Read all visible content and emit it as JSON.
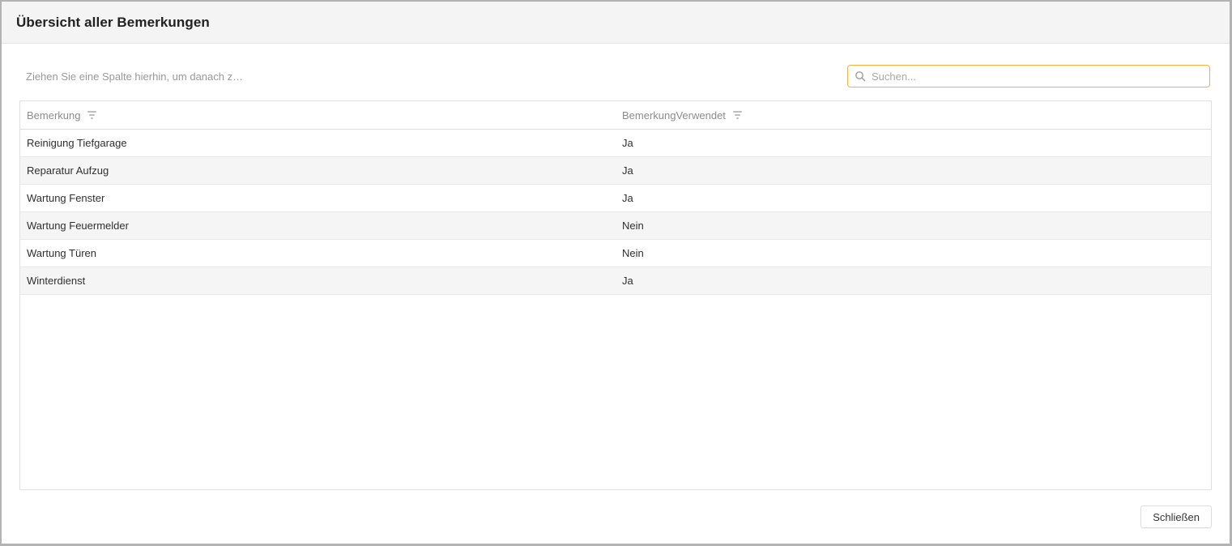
{
  "dialog": {
    "title": "Übersicht aller Bemerkungen"
  },
  "grid": {
    "group_panel_text": "Ziehen Sie eine Spalte hierhin, um danach z…",
    "search": {
      "placeholder": "Suchen...",
      "value": "",
      "icon": "magnifier"
    },
    "columns": [
      {
        "label": "Bemerkung",
        "filter_icon": "funnel"
      },
      {
        "label": "BemerkungVerwendet",
        "filter_icon": "funnel"
      }
    ],
    "rows": [
      {
        "bemerkung": "Reinigung Tiefgarage",
        "verwendet": "Ja"
      },
      {
        "bemerkung": "Reparatur Aufzug",
        "verwendet": "Ja"
      },
      {
        "bemerkung": "Wartung Fenster",
        "verwendet": "Ja"
      },
      {
        "bemerkung": "Wartung Feuermelder",
        "verwendet": "Nein"
      },
      {
        "bemerkung": "Wartung Türen",
        "verwendet": "Nein"
      },
      {
        "bemerkung": "Winterdienst",
        "verwendet": "Ja"
      }
    ]
  },
  "footer": {
    "close_label": "Schließen"
  },
  "colors": {
    "accent": "#edb348",
    "header_bar_bg": "#f4f4f4",
    "alt_row_bg": "#f5f5f5",
    "grid_border": "#e0e0e0",
    "window_border": "#b3b3b3"
  }
}
